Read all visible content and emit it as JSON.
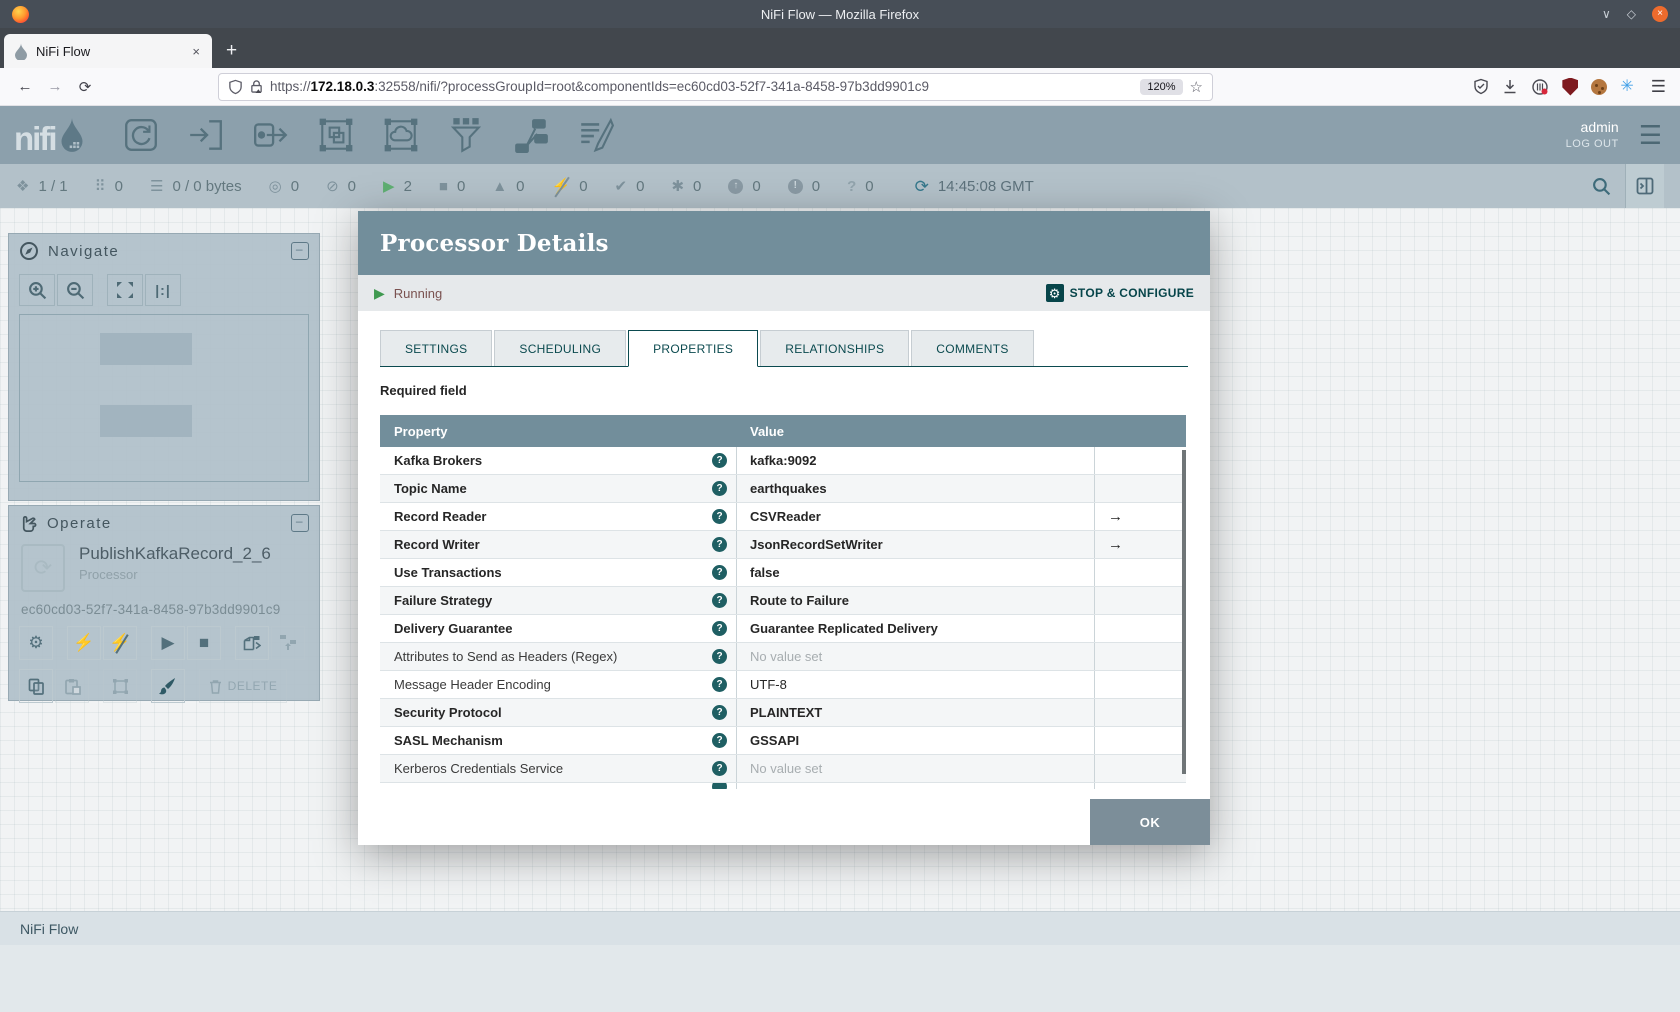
{
  "window": {
    "title": "NiFi Flow — Mozilla Firefox"
  },
  "browser": {
    "tab_title": "NiFi Flow",
    "url": {
      "scheme": "https://",
      "host": "172.18.0.3",
      "rest": ":32558/nifi/?processGroupId=root&componentIds=ec60cd03-52f7-341a-8458-97b3dd9901c9"
    },
    "zoom_badge": "120%"
  },
  "icons": {
    "back": "←",
    "forward": "→",
    "reload": "⟳",
    "star": "☆",
    "hamburger": "☰",
    "new_tab": "+",
    "close_tab": "×",
    "close_window": "×",
    "chevron_down": "∨",
    "restore": "◇",
    "pinwheel": "✳",
    "minus": "–",
    "gear": "⚙",
    "bolt": "⚡",
    "play": "▶",
    "stop": "■",
    "refresh": "⟳",
    "goto_arrow": "→",
    "help": "?",
    "actual_size": "|:|",
    "comp_process": "⟳"
  },
  "nifi_header": {
    "logo_text": "nifi",
    "user": "admin",
    "logout_label": "LOG OUT"
  },
  "status_bar": {
    "items": [
      {
        "name": "cluster-icon",
        "glyph": "❖",
        "value": "1 / 1"
      },
      {
        "name": "active-threads-icon",
        "glyph": "⠿",
        "value": "0"
      },
      {
        "name": "queued-icon",
        "glyph": "☰",
        "value": "0 / 0 bytes"
      },
      {
        "name": "transmitting-icon",
        "glyph": "◎",
        "value": "0"
      },
      {
        "name": "not-transmitting-icon",
        "glyph": "⊘",
        "value": "0"
      },
      {
        "name": "running-icon",
        "glyph": "▶",
        "value": "2",
        "color": "#5FAF72"
      },
      {
        "name": "stopped-icon",
        "glyph": "■",
        "value": "0"
      },
      {
        "name": "invalid-icon",
        "glyph": "▲",
        "value": "0"
      },
      {
        "name": "disabled-icon",
        "glyph": "⚡",
        "value": "0",
        "style": "slash"
      },
      {
        "name": "up-to-date-icon",
        "glyph": "✔",
        "value": "0"
      },
      {
        "name": "locally-modified-icon",
        "glyph": "✱",
        "value": "0"
      },
      {
        "name": "stale-icon",
        "glyph": "↑",
        "value": "0",
        "style": "circle"
      },
      {
        "name": "sync-failure-icon",
        "glyph": "!",
        "value": "0",
        "style": "circle"
      },
      {
        "name": "questioned-icon",
        "glyph": "?",
        "value": "0",
        "style": "plainq"
      }
    ],
    "refresh_time": "14:45:08 GMT"
  },
  "navigate_panel": {
    "title": "Navigate"
  },
  "operate_panel": {
    "title": "Operate",
    "component_name": "PublishKafkaRecord_2_6",
    "component_type": "Processor",
    "component_id": "ec60cd03-52f7-341a-8458-97b3dd9901c9",
    "delete_label": "DELETE"
  },
  "dialog": {
    "title": "Processor Details",
    "status_label": "Running",
    "stop_configure_label": "STOP & CONFIGURE",
    "tabs": [
      {
        "label": "SETTINGS",
        "active": false
      },
      {
        "label": "SCHEDULING",
        "active": false
      },
      {
        "label": "PROPERTIES",
        "active": true
      },
      {
        "label": "RELATIONSHIPS",
        "active": false
      },
      {
        "label": "COMMENTS",
        "active": false
      }
    ],
    "required_note": "Required field",
    "table": {
      "columns": [
        "Property",
        "Value"
      ],
      "rows": [
        {
          "property": "Kafka Brokers",
          "value": "kafka:9092",
          "required": true,
          "empty": false,
          "goto": false
        },
        {
          "property": "Topic Name",
          "value": "earthquakes",
          "required": true,
          "empty": false,
          "goto": false
        },
        {
          "property": "Record Reader",
          "value": "CSVReader",
          "required": true,
          "empty": false,
          "goto": true
        },
        {
          "property": "Record Writer",
          "value": "JsonRecordSetWriter",
          "required": true,
          "empty": false,
          "goto": true
        },
        {
          "property": "Use Transactions",
          "value": "false",
          "required": true,
          "empty": false,
          "goto": false
        },
        {
          "property": "Failure Strategy",
          "value": "Route to Failure",
          "required": true,
          "empty": false,
          "goto": false
        },
        {
          "property": "Delivery Guarantee",
          "value": "Guarantee Replicated Delivery",
          "required": true,
          "empty": false,
          "goto": false
        },
        {
          "property": "Attributes to Send as Headers (Regex)",
          "value": "No value set",
          "required": false,
          "empty": true,
          "goto": false
        },
        {
          "property": "Message Header Encoding",
          "value": "UTF-8",
          "required": false,
          "empty": false,
          "goto": false
        },
        {
          "property": "Security Protocol",
          "value": "PLAINTEXT",
          "required": true,
          "empty": false,
          "goto": false
        },
        {
          "property": "SASL Mechanism",
          "value": "GSSAPI",
          "required": true,
          "empty": false,
          "goto": false
        },
        {
          "property": "Kerberos Credentials Service",
          "value": "No value set",
          "required": false,
          "empty": true,
          "goto": false
        }
      ]
    },
    "ok_label": "OK"
  },
  "breadcrumb": {
    "label": "NiFi Flow"
  },
  "colors": {
    "accent_teal": "#0B4A4F",
    "dialog_header": "#728E9B",
    "running_green": "#3F9950",
    "statusbar_bg": "#B3C1C9",
    "nifi_header_bg": "#8CA0AC"
  }
}
